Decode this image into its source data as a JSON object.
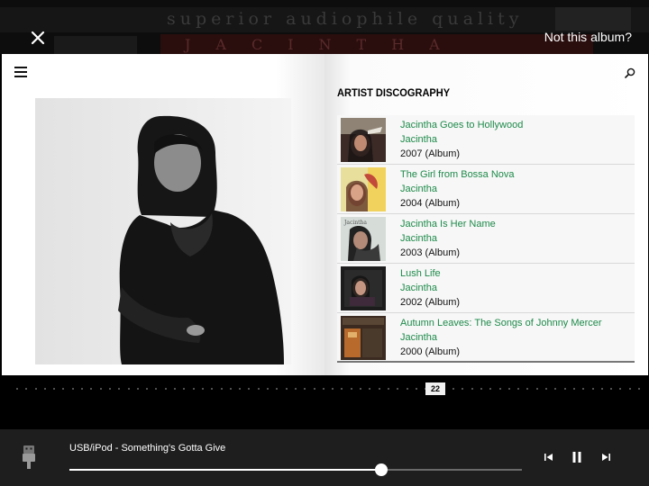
{
  "topbar": {
    "not_album_label": "Not this album?"
  },
  "backdrop": {
    "banner_text": "superior audiophile quality",
    "name_text": "JACINTHA"
  },
  "book": {
    "discography_title": "ARTIST DISCOGRAPHY",
    "albums": [
      {
        "title": "Jacintha Goes to Hollywood",
        "artist": "Jacintha",
        "year": "2007 (Album)"
      },
      {
        "title": "The Girl from Bossa Nova",
        "artist": "Jacintha",
        "year": "2004 (Album)"
      },
      {
        "title": "Jacintha Is Her Name",
        "artist": "Jacintha",
        "year": "2003 (Album)"
      },
      {
        "title": "Lush Life",
        "artist": "Jacintha",
        "year": "2002 (Album)"
      },
      {
        "title": "Autumn Leaves: The Songs of Johnny Mercer",
        "artist": "Jacintha",
        "year": "2000 (Album)"
      }
    ]
  },
  "pager": {
    "current_page": "22",
    "current_fraction": 0.672
  },
  "player": {
    "track_text": "USB/iPod - Something's Gotta Give",
    "progress": 0.689
  },
  "colors": {
    "link_green": "#1d8a4a",
    "player_bg": "#1e1e1e"
  },
  "icons": [
    "close-icon",
    "menu-icon",
    "search-icon",
    "usb-icon",
    "previous-icon",
    "pause-icon",
    "next-icon"
  ]
}
